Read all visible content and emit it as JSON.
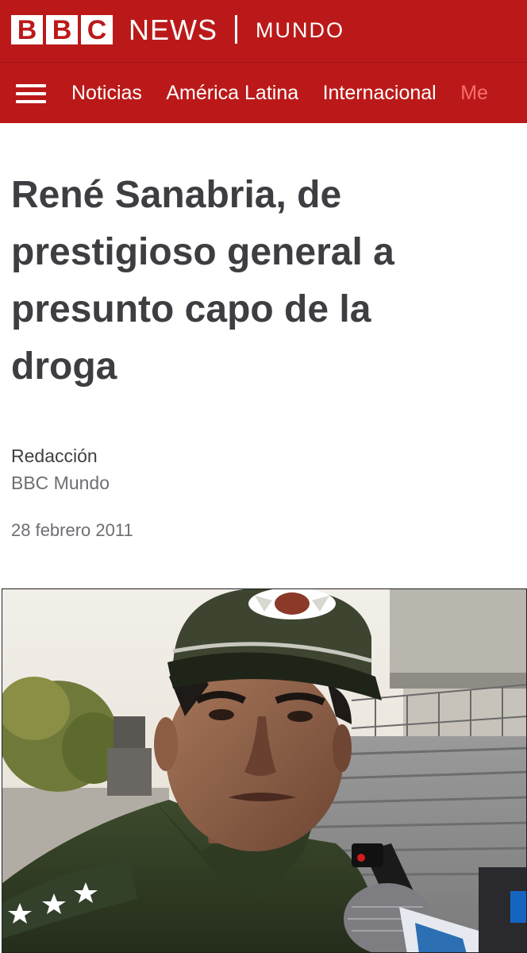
{
  "masthead": {
    "logo_letters": [
      "B",
      "B",
      "C"
    ],
    "news_label": "NEWS",
    "section_label": "MUNDO",
    "brand_color": "#bb1919"
  },
  "nav": {
    "menu_icon": "hamburger-menu-icon",
    "items": [
      {
        "label": "Noticias"
      },
      {
        "label": "América Latina"
      },
      {
        "label": "Internacional"
      },
      {
        "label": "Me"
      }
    ]
  },
  "article": {
    "headline": "René Sanabria, de prestigioso general a presunto capo de la droga",
    "byline_name": "Redacción",
    "byline_org": "BBC Mundo",
    "date": "28 febrero 2011",
    "photo_subject": "uniformed-officer-photo"
  }
}
